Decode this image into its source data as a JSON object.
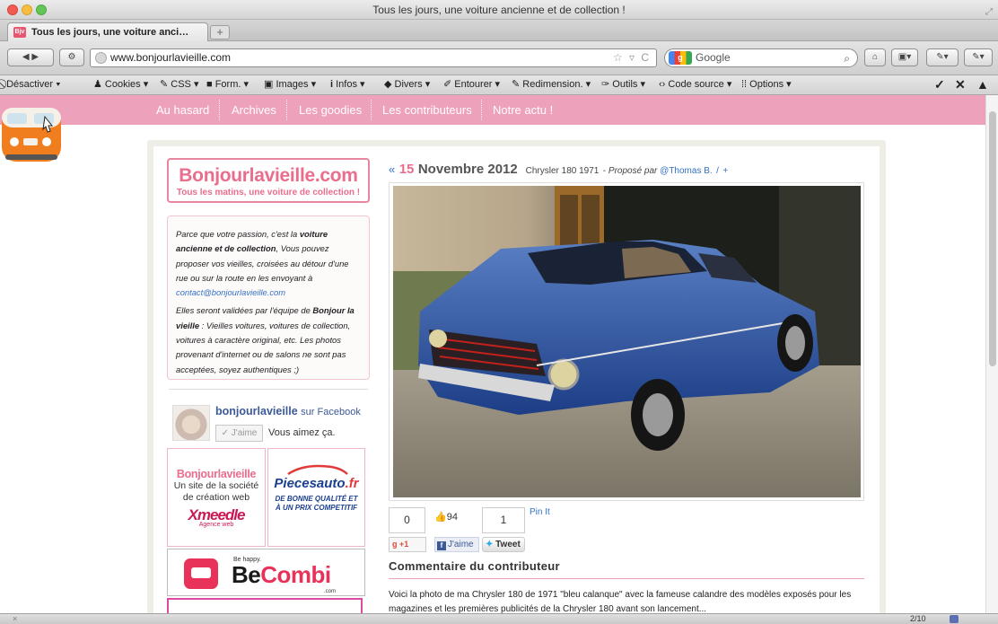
{
  "window": {
    "title": "Tous les jours, une voiture ancienne et de collection !"
  },
  "tabs": [
    {
      "label": "Tous les jours, une voiture anci…",
      "favicon_text": "Bjv"
    }
  ],
  "tab_new_label": "+",
  "nav": {
    "url": "www.bonjourlavieille.com",
    "url_right_icons": "☆ ▿ C",
    "search_placeholder": "Google",
    "search_engine_logo": "g",
    "search_icon": "🔍"
  },
  "webdev_toolbar": {
    "items": [
      "Désactiver ▾",
      "Cookies ▾",
      "CSS ▾",
      "Form. ▾",
      "Images ▾",
      "Infos ▾",
      "Divers ▾",
      "Entourer ▾",
      "Redimension. ▾",
      "Outils ▾",
      "Code source ▾",
      "Options ▾"
    ],
    "icons": [
      "⃠",
      "♟",
      "✎",
      "■",
      "▣",
      "i",
      "◆",
      "✐",
      "✎",
      "✑",
      "‹›",
      "|||"
    ],
    "right": [
      "✓",
      "✕",
      "▲"
    ]
  },
  "site_nav": {
    "items": [
      "Au hasard",
      "Archives",
      "Les goodies",
      "Les contributeurs",
      "Notre actu !"
    ]
  },
  "brand": {
    "title": "Bonjourlavieille.com",
    "subtitle": "Tous les matins, une voiture de collection !"
  },
  "intro": {
    "p1_a": "Parce que votre passion, c'est la ",
    "p1_b": "voiture ancienne et de collection",
    "p1_c": ", Vous pouvez proposer vos vieilles, croisées au détour d'une rue ou sur la route en les envoyant à ",
    "p1_link": "contact@bonjourlavieille.com",
    "p2_a": "Elles seront validées par l'équipe de ",
    "p2_b": "Bonjour la vieille",
    "p2_c": " : Vieilles voitures, voitures de collection, voitures à caractère original, etc. Les photos provenant d'internet ou de salons ne sont pas acceptées, soyez authentiques ;)"
  },
  "facebook_box": {
    "name": "bonjourlavieille",
    "sur": "sur Facebook",
    "like_button": "✓ J'aime",
    "aimez": "Vous aimez ça."
  },
  "ads": {
    "ad1_title": "Bonjourlavieille",
    "ad1_line1": "Un site de la société",
    "ad1_line2": "de création web",
    "ad1_brand": "Xmeedle",
    "ad1_agence": "Agence web",
    "ad2_brand_a": "Piecesauto",
    "ad2_brand_b": ".fr",
    "ad2_line1": "DE BONNE QUALITÉ ET",
    "ad2_line2": "À UN PRIX COMPETITIF",
    "ad3_behappy": "Be happy.",
    "ad3_be": "Be",
    "ad3_combi": "Combi",
    "ad3_com": ".com"
  },
  "post": {
    "prev": "«",
    "day": "15",
    "month_year": "Novembre 2012",
    "car": "Chrysler 180 1971",
    "propose": "Proposé par",
    "author": "@Thomas B.",
    "sep": "/",
    "plus": "+"
  },
  "share": {
    "count0": "0",
    "fb_count": "94",
    "count1": "1",
    "pinit": "Pin It",
    "gplus": "+1",
    "fb_jaime": "J'aime",
    "tweet": "Tweet"
  },
  "comment": {
    "title": "Commentaire du contributeur",
    "body": "Voici la photo de ma Chrysler 180 de 1971 \"bleu calanque\" avec la fameuse calandre des modèles exposés pour les magazines et les premières publicités de la Chrysler 180 avant son lancement..."
  },
  "status": {
    "close": "×",
    "page": "2/10"
  }
}
